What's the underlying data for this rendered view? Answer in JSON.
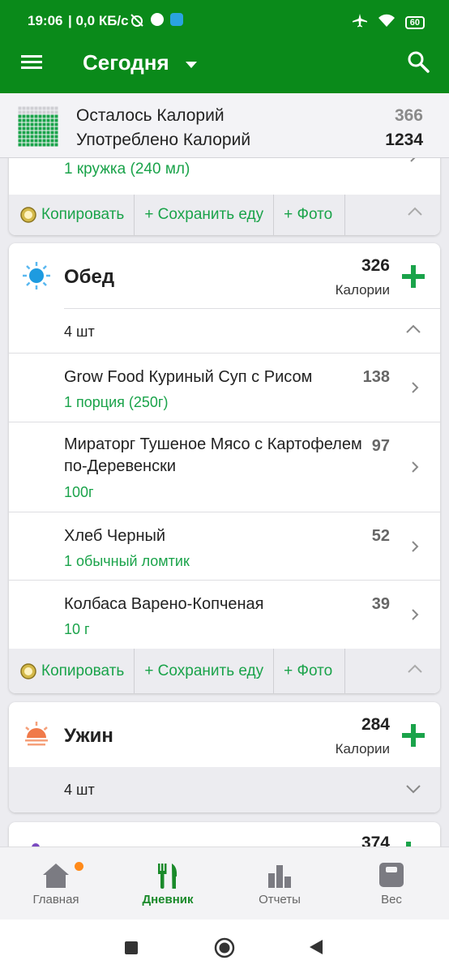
{
  "status_bar": {
    "time": "19:06",
    "speed": "| 0,0 КБ/с",
    "battery": "60"
  },
  "app_bar": {
    "title": "Сегодня"
  },
  "summary": {
    "remaining_label": "Осталось Калорий",
    "remaining_value": "366",
    "consumed_label": "Употреблено Калорий",
    "consumed_value": "1234"
  },
  "prev_meal": {
    "last_serving": "1 кружка (240 мл)"
  },
  "actions": {
    "copy": "Копировать",
    "save": "+ Сохранить еду",
    "photo": "+ Фото"
  },
  "lunch": {
    "name": "Обед",
    "calories": "326",
    "calories_label": "Калории",
    "count": "4 шт",
    "items": [
      {
        "name": "Grow Food  Куриный Суп с Рисом",
        "serving": "1 порция (250г)",
        "calories": "138"
      },
      {
        "name": "Мираторг Тушеное Мясо с Картофелем по-Деревенски",
        "serving": "100г",
        "calories": "97"
      },
      {
        "name": "Хлеб Черный",
        "serving": "1 обычный ломтик",
        "calories": "52"
      },
      {
        "name": "Колбаса Варено-Копченая",
        "serving": "10 г",
        "calories": "39"
      }
    ]
  },
  "dinner": {
    "name": "Ужин",
    "calories": "284",
    "calories_label": "Калории",
    "count": "4 шт"
  },
  "snack": {
    "calories": "374"
  },
  "bottom_nav": [
    {
      "label": "Главная",
      "icon": "home-icon"
    },
    {
      "label": "Дневник",
      "icon": "fork-knife-icon"
    },
    {
      "label": "Отчеты",
      "icon": "bar-chart-icon"
    },
    {
      "label": "Вес",
      "icon": "scale-icon"
    }
  ],
  "colors": {
    "brand_green": "#0a8a1a",
    "accent_green": "#1aa34a",
    "background": "#ececf0",
    "notification": "#ff8a1a"
  }
}
